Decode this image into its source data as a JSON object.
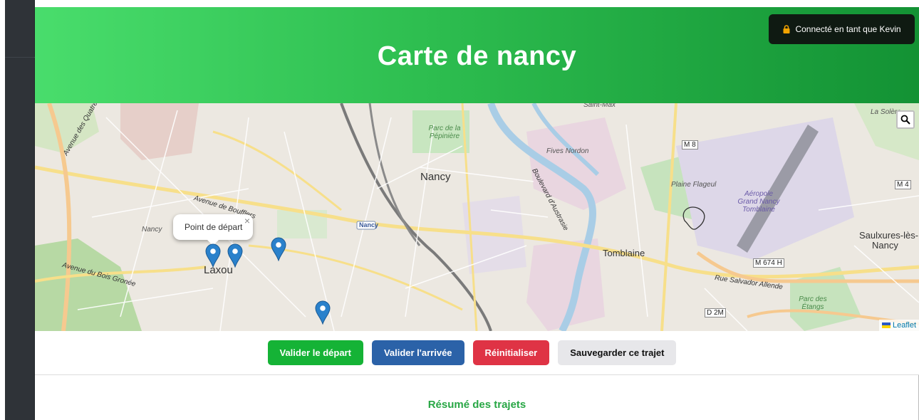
{
  "header": {
    "title": "Carte de nancy",
    "user_badge": "Connecté en tant que Kevin"
  },
  "map": {
    "labels": {
      "nancy": "Nancy",
      "laxou": "Laxou",
      "tomblaine": "Tomblaine",
      "saulxures": "Saulxures-lès-",
      "saulxures2": "Nancy",
      "fives_nordon": "Fives Nordon",
      "plaine_flageul": "Plaine Flageul",
      "aeroport": "Aéropole Grand Nancy Tomblaine",
      "parc_pepiniere": "Parc de la Pépinière",
      "parc_etangs": "Parc des Étangs",
      "la_solere": "La Solère",
      "saint_max": "Saint-Max",
      "avenue_boufflers": "Avenue de Boufflers",
      "avenue_quatre_vents": "Avenue des Quatre Vents",
      "avenue_bois_gronee": "Avenue du Bois Gronée",
      "boulevard_austrasie": "Boulevard d'Austrasie",
      "rue_salvador": "Rue Salvador Allende",
      "nancy_small": "Nancy",
      "m8": "M 8",
      "m4": "M 4",
      "m674h": "M 674 H",
      "d2m": "D 2M",
      "station": "Nancy"
    },
    "popup_text": "Point de départ",
    "attribution": "Leaflet",
    "icons": {
      "search": "search-icon",
      "marker": "map-marker-icon",
      "lock": "lock-icon",
      "close": "close-icon"
    }
  },
  "controls": {
    "validate_start": "Valider le départ",
    "validate_end": "Valider l'arrivée",
    "reset": "Réinitialiser",
    "save": "Sauvegarder ce trajet"
  },
  "summary": {
    "title": "Résumé des trajets"
  },
  "colors": {
    "header_start": "#49dd6c",
    "header_end": "#139234",
    "green_button": "#15b336",
    "blue_button": "#2b62a8",
    "red_button": "#df3345",
    "grey_button": "#e7e7ea",
    "summary_title": "#28a745",
    "marker": "#2a81cb"
  }
}
